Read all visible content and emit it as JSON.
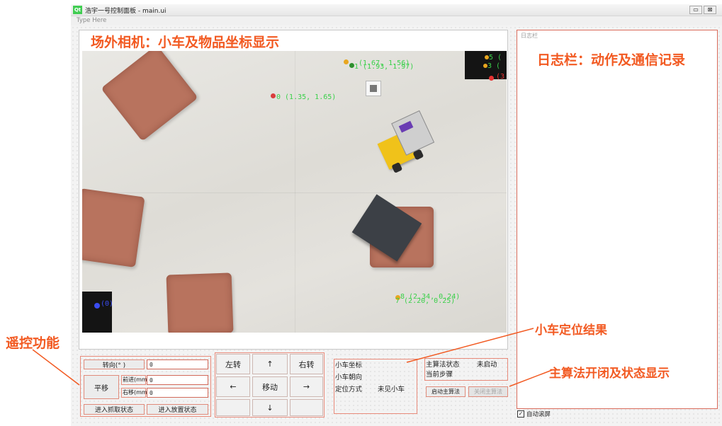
{
  "window": {
    "title": "浩宇一号控制面板 - main.ui",
    "menu_placeholder": "Type Here",
    "minimize_glyph": "▭",
    "close_glyph": "⊠"
  },
  "annotations": {
    "camera": "场外相机：小车及物品坐标显示",
    "log": "日志栏：动作及通信记录",
    "remote": "遥控功能",
    "locate": "小车定位结果",
    "algo": "主算法开闭及状态显示"
  },
  "camera": {
    "markers": [
      {
        "text": "(1.67, 1.56)",
        "color": "#3ad04a"
      },
      {
        "text": "1 (1.93, 1.97)",
        "color": "#3ad04a"
      },
      {
        "text": "0 (1.35, 1.65)",
        "color": "#3ad04a"
      },
      {
        "text": "5 (",
        "color": "#3ad04a"
      },
      {
        "text": "3 (",
        "color": "#3ad04a"
      },
      {
        "text": "(3",
        "color": "#e63232"
      },
      {
        "text": "(0)",
        "color": "#3a4cf0"
      },
      {
        "text": "8 (2.34, 0.24)",
        "color": "#3ad04a"
      },
      {
        "text": "7 (2.20, 0.25)",
        "color": "#3ad04a"
      }
    ]
  },
  "log_panel": {
    "title": "日志栏",
    "auto_scroll_label": "自动滚屏",
    "auto_scroll_checked": true
  },
  "remote": {
    "turn_button": "转向(° )",
    "turn_value": "0",
    "translate_button": "平移",
    "forward_label": "前进(mm)",
    "forward_value": "0",
    "right_label": "右移(mm)",
    "right_value": "0",
    "grab_button": "进入抓取状态",
    "place_button": "进入放置状态"
  },
  "dpad": {
    "left_turn": "左转",
    "up": "↑",
    "right_turn": "右转",
    "left": "←",
    "move": "移动",
    "right": "→",
    "down": "↓"
  },
  "locate": {
    "coord_label": "小车坐标",
    "coord_value": "",
    "heading_label": "小车朝向",
    "heading_value": "",
    "method_label": "定位方式",
    "method_value": "未见小车"
  },
  "algo": {
    "state_label": "主算法状态",
    "state_value": "未启动",
    "step_label": "当前步骤",
    "step_value": "",
    "start_button": "启动主算法",
    "stop_button": "关闭主算法",
    "stop_enabled": false
  },
  "colors": {
    "annotation": "#f25a22",
    "red_border": "#e88a7a",
    "marker_green": "#3ad04a",
    "tile": "#b8735e"
  }
}
